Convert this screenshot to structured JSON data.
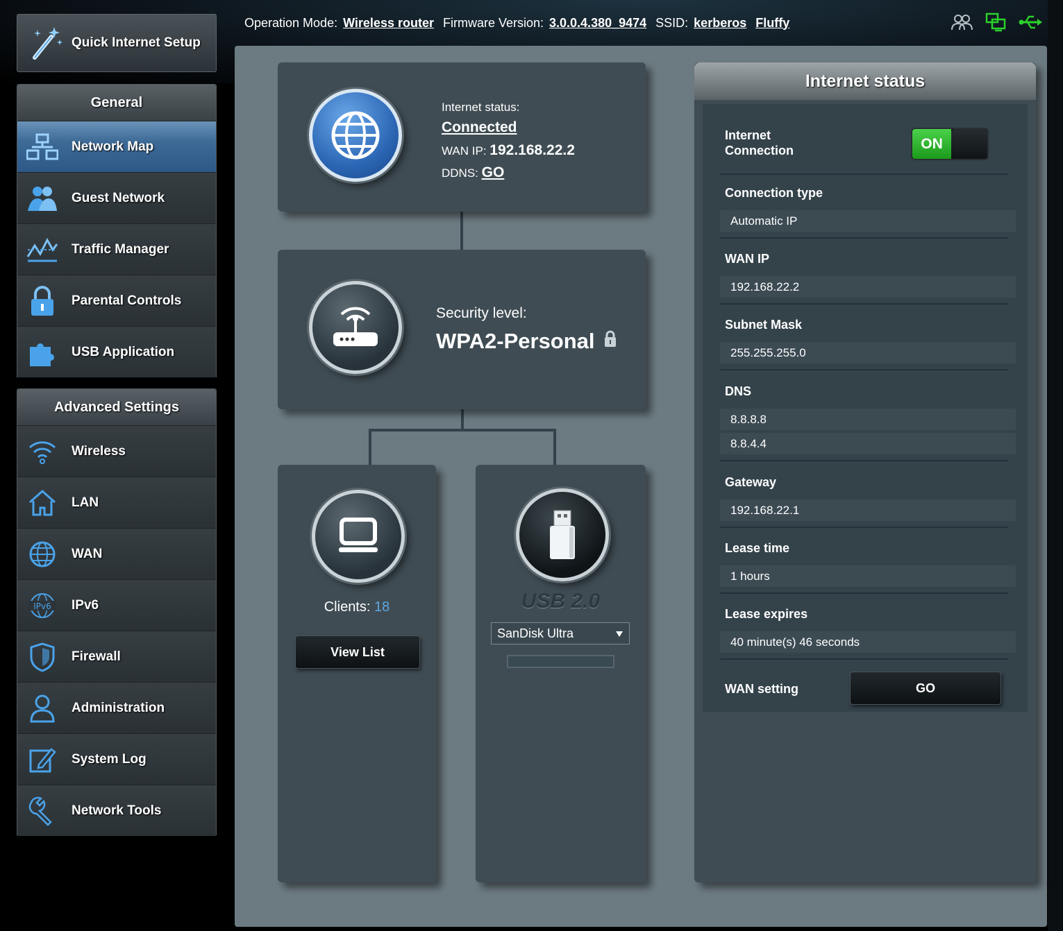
{
  "topbar": {
    "operation_mode_label": "Operation Mode:",
    "operation_mode": "Wireless router",
    "firmware_label": "Firmware Version:",
    "firmware": "3.0.0.4.380_9474",
    "ssid_label": "SSID:",
    "ssid_1": "kerberos",
    "ssid_2": "Fluffy",
    "icons": [
      "users-icon",
      "network-status-icon",
      "usb-status-icon"
    ]
  },
  "sidebar": {
    "quick_setup": "Quick Internet Setup",
    "general_title": "General",
    "general_items": [
      {
        "label": "Network Map",
        "icon": "network-map-icon",
        "active": true
      },
      {
        "label": "Guest Network",
        "icon": "guest-network-icon"
      },
      {
        "label": "Traffic Manager",
        "icon": "traffic-manager-icon"
      },
      {
        "label": "Parental Controls",
        "icon": "lock-icon"
      },
      {
        "label": "USB Application",
        "icon": "puzzle-icon"
      }
    ],
    "advanced_title": "Advanced Settings",
    "advanced_items": [
      {
        "label": "Wireless",
        "icon": "wifi-icon"
      },
      {
        "label": "LAN",
        "icon": "house-icon"
      },
      {
        "label": "WAN",
        "icon": "globe-icon"
      },
      {
        "label": "IPv6",
        "icon": "ipv6-icon"
      },
      {
        "label": "Firewall",
        "icon": "shield-icon"
      },
      {
        "label": "Administration",
        "icon": "person-icon"
      },
      {
        "label": "System Log",
        "icon": "edit-icon"
      },
      {
        "label": "Network Tools",
        "icon": "wrench-icon"
      }
    ]
  },
  "map": {
    "internet_status_label": "Internet status:",
    "internet_status": "Connected",
    "wan_ip_label": "WAN IP:",
    "wan_ip": "192.168.22.2",
    "ddns_label": "DDNS:",
    "ddns": "GO",
    "security_label": "Security level:",
    "security_value": "WPA2-Personal",
    "clients_label": "Clients:",
    "clients_count": "18",
    "view_list": "View List",
    "usb_label": "USB 2.0",
    "usb_device": "SanDisk Ultra"
  },
  "status": {
    "title": "Internet status",
    "internet_connection_label_1": "Internet",
    "internet_connection_label_2": "Connection",
    "toggle": "ON",
    "connection_type_label": "Connection type",
    "connection_type": "Automatic IP",
    "wan_ip_label": "WAN IP",
    "wan_ip": "192.168.22.2",
    "subnet_label": "Subnet Mask",
    "subnet": "255.255.255.0",
    "dns_label": "DNS",
    "dns_1": "8.8.8.8",
    "dns_2": "8.8.4.4",
    "gateway_label": "Gateway",
    "gateway": "192.168.22.1",
    "lease_time_label": "Lease time",
    "lease_time": "1 hours",
    "lease_expires_label": "Lease expires",
    "lease_expires": "40 minute(s) 46 seconds",
    "wan_setting_label": "WAN setting",
    "wan_setting_button": "GO"
  },
  "colors": {
    "accent_blue": "#3d6a97",
    "clients_count": "#5fa8e0",
    "toggle_on": "#2fb52f",
    "icon_blue": "#4aa3ea"
  }
}
